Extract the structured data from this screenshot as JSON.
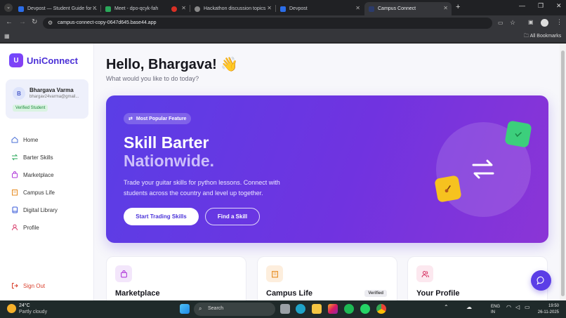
{
  "browser": {
    "tabs": [
      {
        "label": "Devpost — Student Guide for ...",
        "color": "#2b6de8"
      },
      {
        "label": "Meet - dpo-qcyk-fah",
        "color": "#2aa85a"
      },
      {
        "label": "",
        "color": "#d93025"
      },
      {
        "label": "Hackathon discussion topics",
        "color": "#888888"
      },
      {
        "label": "Devpost",
        "color": "#2b6de8"
      },
      {
        "label": "Campus Connect",
        "color": "#2b3b6b"
      }
    ],
    "url": "campus-connect-copy-0647d645.base44.app",
    "all_bookmarks": "All Bookmarks"
  },
  "sidebar": {
    "logo_letter": "U",
    "logo_text": "UniConnect",
    "user": {
      "initial": "B",
      "name": "Bhargava Varma",
      "email": "bhargav24varma@gmail...",
      "badge": "Verified Student"
    },
    "nav": [
      {
        "label": "Home",
        "icon": "home-icon"
      },
      {
        "label": "Barter Skills",
        "icon": "swap-icon"
      },
      {
        "label": "Marketplace",
        "icon": "shopping-bag-icon"
      },
      {
        "label": "Campus Life",
        "icon": "building-icon"
      },
      {
        "label": "Digital Library",
        "icon": "book-icon"
      },
      {
        "label": "Profile",
        "icon": "user-icon"
      }
    ],
    "sign_out": "Sign Out"
  },
  "main": {
    "greeting": "Hello, Bhargava! 👋",
    "subtitle": "What would you like to do today?",
    "hero": {
      "pill": "Most Popular Feature",
      "title_line1": "Skill Barter",
      "title_line2": "Nationwide.",
      "description": "Trade your guitar skills for python lessons. Connect with students across the country and level up together.",
      "primary_button": "Start Trading Skills",
      "secondary_button": "Find a Skill"
    },
    "cards": [
      {
        "title": "Marketplace",
        "badge": "",
        "icon": "shopping-bag-icon",
        "color": "#f3e6fb"
      },
      {
        "title": "Campus Life",
        "badge": "Verified",
        "icon": "building-icon",
        "color": "#fdeedd"
      },
      {
        "title": "Your Profile",
        "badge": "",
        "icon": "users-icon",
        "color": "#fce8ef"
      }
    ]
  },
  "taskbar": {
    "temperature": "24°C",
    "weather": "Partly cloudy",
    "search": "Search",
    "lang1": "ENG",
    "lang2": "IN",
    "time": "19:50",
    "date": "26-11-2025"
  }
}
